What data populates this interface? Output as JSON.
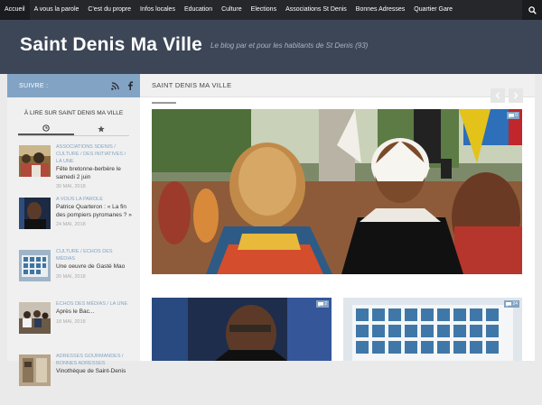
{
  "topnav": {
    "items": [
      {
        "label": "Accueil"
      },
      {
        "label": "A vous la parole"
      },
      {
        "label": "C'est du propre"
      },
      {
        "label": "Infos locales"
      },
      {
        "label": "Education"
      },
      {
        "label": "Culture"
      },
      {
        "label": "Elections"
      },
      {
        "label": "Associations St Denis"
      },
      {
        "label": "Bonnes Adresses"
      },
      {
        "label": "Quartier Gare"
      }
    ],
    "search_icon": "search-icon"
  },
  "header": {
    "title": "Saint Denis Ma Ville",
    "tagline": "Le blog par et pour les habitants de St Denis (93)"
  },
  "sidebar": {
    "follow_label": "SUIVRE :",
    "widget_title": "À LIRE SUR SAINT DENIS MA VILLE",
    "posts": [
      {
        "category": "ASSOCIATIONS SDENIS / CULTURE / DES INITIATIVES / LA UNE",
        "title": "Fête bretonne-berbère le samedi 2 juin",
        "date": "30 MAI, 2018"
      },
      {
        "category": "A VOUS LA PAROLE",
        "title": "Patrice Quarteron : « La fin des pompiers pyromanes ? »",
        "date": "24 MAI, 2018"
      },
      {
        "category": "CULTURE / ECHOS DES MÉDIAS",
        "title": "Une oeuvre de Gasté Mao",
        "date": "20 MAI, 2018"
      },
      {
        "category": "ECHOS DES MÉDIAS / LA UNE",
        "title": "Après le Bac...",
        "date": "18 MAI, 2018"
      },
      {
        "category": "ADRESSES GOURMANDES / BONNES ADRESSES",
        "title": "Vinothèque de Saint-Denis",
        "date": ""
      }
    ]
  },
  "main": {
    "featured_label": "SAINT DENIS MA VILLE",
    "feature_comments": "0",
    "cards": [
      {
        "comments": "2"
      },
      {
        "comments": "24"
      }
    ]
  },
  "colors": {
    "accent": "#82a3c4",
    "header_bg": "#3c4656",
    "nav_bg": "#26272b"
  }
}
